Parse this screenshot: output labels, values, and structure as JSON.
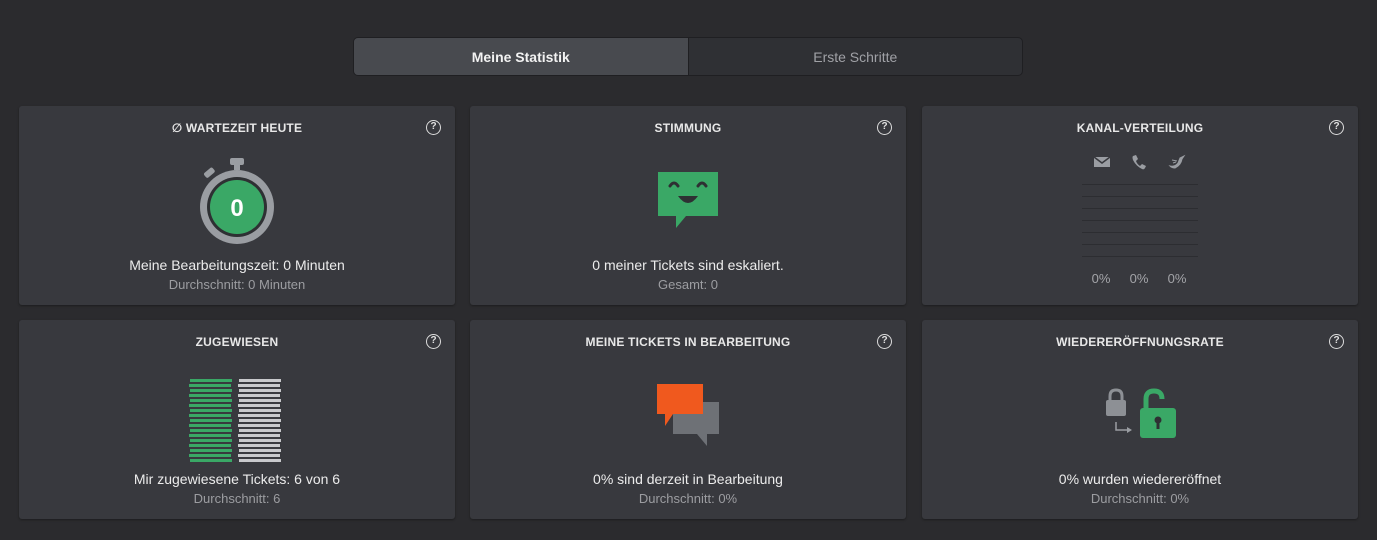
{
  "tabs": [
    {
      "label": "Meine Statistik",
      "active": true
    },
    {
      "label": "Erste Schritte",
      "active": false
    }
  ],
  "cards": {
    "wartezeit": {
      "title": "∅ WARTEZEIT HEUTE",
      "value": "0",
      "main": "Meine Bearbeitungszeit: 0 Minuten",
      "sub": "Durchschnitt: 0 Minuten"
    },
    "stimmung": {
      "title": "STIMMUNG",
      "main": "0 meiner Tickets sind eskaliert.",
      "sub": "Gesamt: 0"
    },
    "kanal": {
      "title": "KANAL-VERTEILUNG",
      "channels": [
        {
          "icon": "mail-icon",
          "percent": "0%"
        },
        {
          "icon": "phone-icon",
          "percent": "0%"
        },
        {
          "icon": "twitter-icon",
          "percent": "0%"
        }
      ]
    },
    "zugewiesen": {
      "title": "ZUGEWIESEN",
      "main": "Mir zugewiesene Tickets: 6 von 6",
      "sub": "Durchschnitt: 6"
    },
    "bearbeitung": {
      "title": "MEINE TICKETS IN BEARBEITUNG",
      "main": "0% sind derzeit in Bearbeitung",
      "sub": "Durchschnitt: 0%"
    },
    "wiedereroeffnung": {
      "title": "WIEDERERÖFFNUNGSRATE",
      "main": "0% wurden wiedereröffnet",
      "sub": "Durchschnitt: 0%"
    }
  },
  "help_label": "?",
  "colors": {
    "background": "#2b2b2e",
    "card": "#38393e",
    "green": "#3aa866",
    "orange": "#f0591e",
    "gray_icon": "#9a9da2"
  }
}
